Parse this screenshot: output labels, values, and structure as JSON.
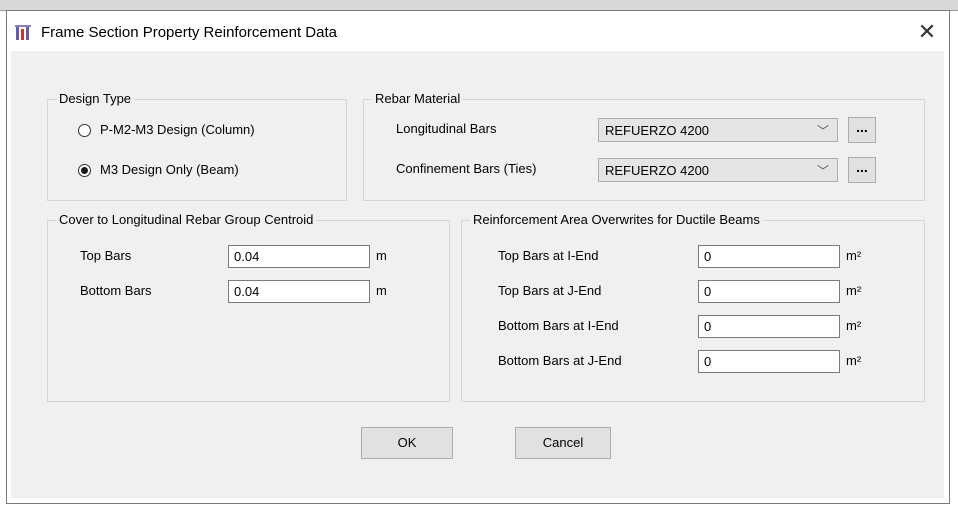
{
  "window": {
    "title": "Frame Section Property Reinforcement Data",
    "close": "✕"
  },
  "design_type": {
    "label": "Design Type",
    "options": [
      {
        "label": "P-M2-M3 Design  (Column)",
        "selected": false
      },
      {
        "label": "M3 Design Only  (Beam)",
        "selected": true
      }
    ]
  },
  "rebar_material": {
    "label": "Rebar Material",
    "longitudinal": {
      "label": "Longitudinal Bars",
      "value": "REFUERZO 4200",
      "browse": "..."
    },
    "confinement": {
      "label": "Confinement Bars (Ties)",
      "value": "REFUERZO 4200",
      "browse": "..."
    }
  },
  "cover": {
    "label": "Cover to Longitudinal Rebar Group Centroid",
    "top": {
      "label": "Top Bars",
      "value": "0.04",
      "unit": "m"
    },
    "bottom": {
      "label": "Bottom  Bars",
      "value": "0.04",
      "unit": "m"
    }
  },
  "overwrites": {
    "label": "Reinforcement Area Overwrites for Ductile Beams",
    "rows": [
      {
        "label": "Top Bars at I-End",
        "value": "0",
        "unit": "m²"
      },
      {
        "label": "Top Bars at J-End",
        "value": "0",
        "unit": "m²"
      },
      {
        "label": "Bottom Bars at I-End",
        "value": "0",
        "unit": "m²"
      },
      {
        "label": "Bottom Bars at J-End",
        "value": "0",
        "unit": "m²"
      }
    ]
  },
  "buttons": {
    "ok": "OK",
    "cancel": "Cancel"
  },
  "icons": {
    "dropdown": "chevron-down-icon",
    "app": "frame-section-icon"
  }
}
